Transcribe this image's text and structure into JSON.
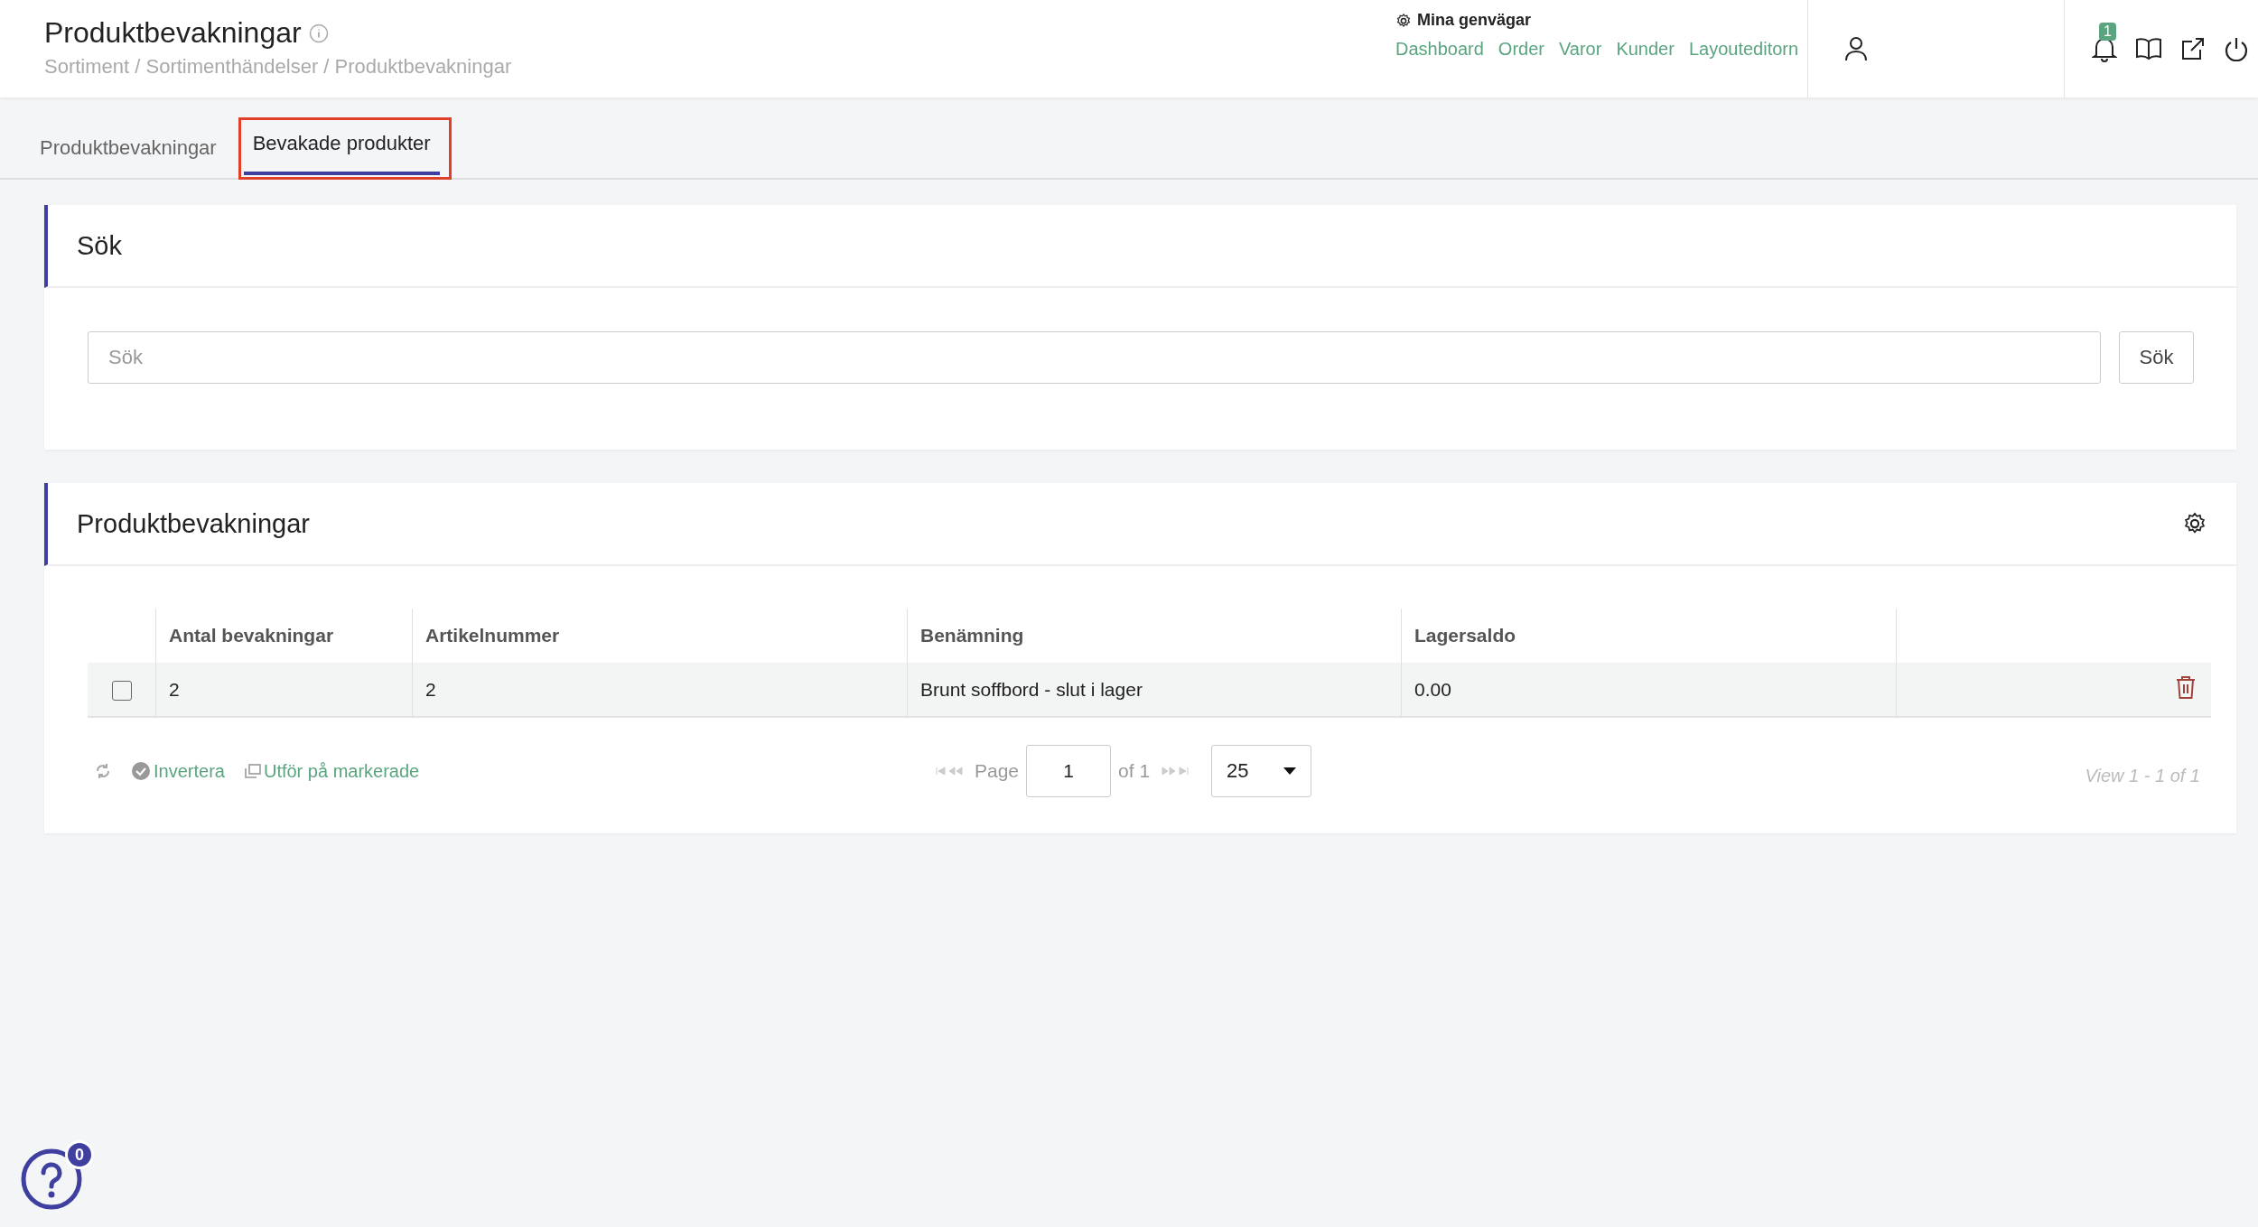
{
  "header": {
    "title": "Produktbevakningar",
    "breadcrumb": "Sortiment / Sortimenthändelser / Produktbevakningar",
    "shortcuts": {
      "title": "Mina genvägar",
      "links": [
        "Dashboard",
        "Order",
        "Varor",
        "Kunder",
        "Layouteditorn"
      ]
    },
    "notification_count": "1"
  },
  "tabs": [
    {
      "label": "Produktbevakningar",
      "selected": false,
      "highlighted": false
    },
    {
      "label": "Bevakade produkter",
      "selected": true,
      "highlighted": true
    }
  ],
  "search_card": {
    "title": "Sök",
    "placeholder": "Sök",
    "button": "Sök"
  },
  "table_card": {
    "title": "Produktbevakningar",
    "columns": [
      "Antal bevakningar",
      "Artikelnummer",
      "Benämning",
      "Lagersaldo"
    ],
    "rows": [
      {
        "checked": false,
        "cells": [
          "2",
          "2",
          "Brunt soffbord - slut i lager",
          "0.00"
        ]
      }
    ],
    "actions": [
      "Invertera",
      "Utför på markerade"
    ],
    "pager": {
      "page_label": "Page",
      "page": "1",
      "of": "of 1",
      "page_size": "25",
      "view": "View 1 - 1 of 1"
    }
  },
  "help": {
    "badge": "0"
  }
}
